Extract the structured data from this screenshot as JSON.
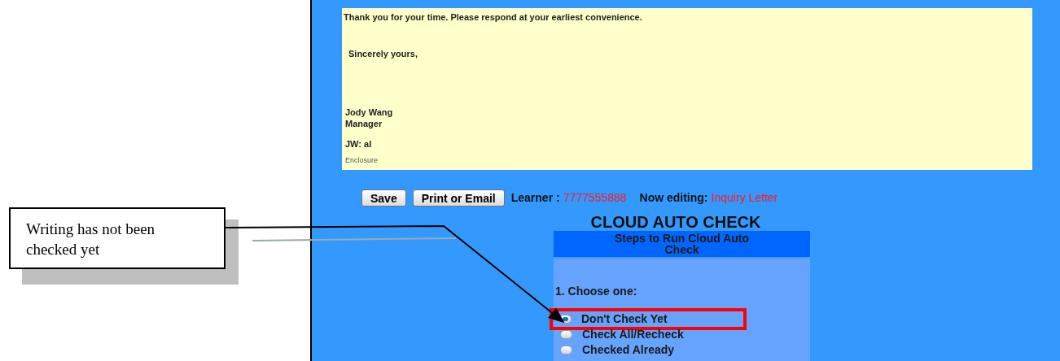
{
  "letter": {
    "closing_line": "Thank you for your time. Please respond at your earliest convenience.",
    "salutation": "Sincerely yours,",
    "signer_name": "Jody Wang",
    "signer_title": "Manager",
    "reference_initials": "JW: al",
    "enclosure": "Enclosure"
  },
  "toolbar": {
    "buttons": [
      "Save",
      "Print or Email"
    ],
    "learner_label": "Learner :",
    "learner_id": "7777555888",
    "editing_label": "Now editing:",
    "editing_document": "Inquiry Letter"
  },
  "auto_check": {
    "title": "CLOUD AUTO CHECK",
    "steps_header": "Steps to Run Cloud Auto Check",
    "step_label": "1. Choose one:",
    "options": [
      {
        "label": "Don't Check Yet",
        "selected": true,
        "highlighted": true
      },
      {
        "label": "Check All/Recheck",
        "selected": false,
        "highlighted": false
      },
      {
        "label": "Checked Already",
        "selected": false,
        "highlighted": false
      }
    ]
  },
  "callout": {
    "text": "Writing has not been checked yet"
  }
}
